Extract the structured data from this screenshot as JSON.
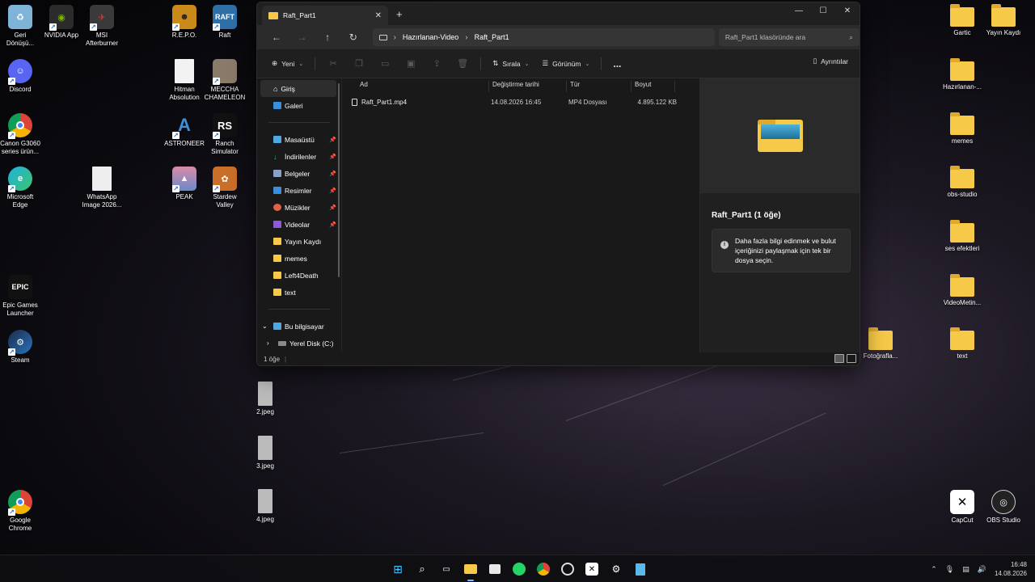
{
  "desktop": {
    "left_icons": [
      {
        "label": "Geri\nDönüşü...",
        "icon": "recycle-bin-icon"
      },
      {
        "label": "NVIDIA App",
        "icon": "nvidia-icon"
      },
      {
        "label": "MSI\nAfterburner",
        "icon": "msi-icon"
      },
      {
        "label": "Discord",
        "icon": "discord-icon"
      },
      {
        "label": "Canon G3060\nseries ürün...",
        "icon": "chrome-icon"
      },
      {
        "label": "Microsoft\nEdge",
        "icon": "edge-icon"
      },
      {
        "label": "WhatsApp\nImage 2026...",
        "icon": "image-file-icon"
      },
      {
        "label": "Epic Games\nLauncher",
        "icon": "epic-icon",
        "glyph": "EPIC"
      },
      {
        "label": "Steam",
        "icon": "steam-icon"
      },
      {
        "label": "Google\nChrome",
        "icon": "chrome-icon"
      },
      {
        "label": "R.E.P.O.",
        "icon": "repo-icon"
      },
      {
        "label": "Raft",
        "icon": "raft-icon",
        "glyph": "RAFT"
      },
      {
        "label": "Hitman\nAbsolution",
        "icon": "file-icon"
      },
      {
        "label": "MECCHA\nCHAMELEON",
        "icon": "game-icon"
      },
      {
        "label": "ASTRONEER",
        "icon": "astroneer-icon",
        "glyph": "A"
      },
      {
        "label": "Ranch\nSimulator",
        "icon": "ranch-icon",
        "glyph": "RS"
      },
      {
        "label": "PEAK",
        "icon": "peak-icon"
      },
      {
        "label": "Stardew\nValley",
        "icon": "stardew-icon"
      },
      {
        "label": "2.jpeg",
        "icon": "image-file-icon"
      },
      {
        "label": "3.jpeg",
        "icon": "image-file-icon"
      },
      {
        "label": "4.jpeg",
        "icon": "image-file-icon"
      }
    ],
    "right_icons": [
      {
        "label": "Gartic",
        "icon": "folder-icon"
      },
      {
        "label": "Yayın Kaydı",
        "icon": "folder-icon"
      },
      {
        "label": "Hazırlanan-...",
        "icon": "folder-icon"
      },
      {
        "label": "memes",
        "icon": "folder-icon"
      },
      {
        "label": "obs-studio",
        "icon": "folder-icon"
      },
      {
        "label": "ses efektleri",
        "icon": "folder-icon"
      },
      {
        "label": "VideoMetin...",
        "icon": "folder-icon"
      },
      {
        "label": "Fotoğrafla...",
        "icon": "folder-icon"
      },
      {
        "label": "text",
        "icon": "folder-icon"
      },
      {
        "label": "CapCut",
        "icon": "capcut-icon"
      },
      {
        "label": "OBS Studio",
        "icon": "obs-icon"
      }
    ]
  },
  "explorer": {
    "tab_title": "Raft_Part1",
    "breadcrumb": [
      "Hazırlanan-Video",
      "Raft_Part1"
    ],
    "search_placeholder": "Raft_Part1 klasöründe ara",
    "commands": {
      "new": "Yeni",
      "sort": "Sırala",
      "view": "Görünüm",
      "more": "...",
      "details": "Ayrıntılar"
    },
    "nav": {
      "home": "Giriş",
      "gallery": "Galeri",
      "pinned": [
        {
          "label": "Masaüstü",
          "color": "#4fa8e0"
        },
        {
          "label": "İndirilenler",
          "color": "#3fb27f"
        },
        {
          "label": "Belgeler",
          "color": "#8aa0c8"
        },
        {
          "label": "Resimler",
          "color": "#3a8fd8"
        },
        {
          "label": "Müzikler",
          "color": "#e0604a"
        },
        {
          "label": "Videolar",
          "color": "#8a5ad8"
        }
      ],
      "folders": [
        "Yayın Kaydı",
        "memes",
        "Left4Death",
        "text"
      ],
      "this_pc": "Bu bilgisayar",
      "local_disk": "Yerel Disk (C:)"
    },
    "columns": {
      "name": "Ad",
      "date": "Değiştirme tarihi",
      "type": "Tür",
      "size": "Boyut"
    },
    "files": [
      {
        "name": "Raft_Part1.mp4",
        "date": "14.08.2026 16:45",
        "type": "MP4 Dosyası",
        "size": "4.895.122 KB"
      }
    ],
    "details": {
      "title": "Raft_Part1 (1 öğe)",
      "info": "Daha fazla bilgi edinmek ve bulut içeriğinizi paylaşmak için tek bir dosya seçin."
    },
    "status": "1 öğe"
  },
  "taskbar": {
    "time": "16:48",
    "date": "14.08.2026"
  },
  "colors": {
    "accent": "#7ab8ff",
    "folder": "#f7c948"
  }
}
